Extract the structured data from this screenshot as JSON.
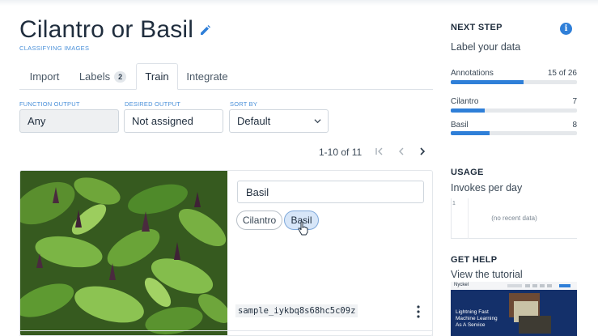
{
  "header": {
    "title": "Cilantro or Basil",
    "subtitle": "CLASSIFYING IMAGES",
    "edit_icon": "pencil-icon"
  },
  "tabs": [
    {
      "label": "Import",
      "active": false
    },
    {
      "label": "Labels",
      "badge": "2",
      "active": false
    },
    {
      "label": "Train",
      "active": true
    },
    {
      "label": "Integrate",
      "active": false
    }
  ],
  "filters": {
    "function_output": {
      "label": "FUNCTION OUTPUT",
      "value": "Any"
    },
    "desired_output": {
      "label": "DESIRED OUTPUT",
      "value": "Not assigned"
    },
    "sort_by": {
      "label": "SORT BY",
      "value": "Default"
    }
  },
  "pagination": {
    "range": "1-10 of 11",
    "icons": [
      "first-page-icon",
      "prev-page-icon",
      "next-page-icon"
    ]
  },
  "sample": {
    "label_value": "Basil",
    "chips": [
      {
        "label": "Cilantro",
        "selected": false
      },
      {
        "label": "Basil",
        "selected": true
      }
    ],
    "id": "sample_iykbq8s68hc5c09z",
    "menu_icon": "more-vertical-icon"
  },
  "sidebar": {
    "next_step": {
      "heading": "NEXT STEP",
      "text": "Label your data",
      "info_icon": "info-icon"
    },
    "metrics": [
      {
        "label": "Annotations",
        "value": "15 of 26",
        "fraction": 0.58
      },
      {
        "label": "Cilantro",
        "value": "7",
        "fraction": 0.27
      },
      {
        "label": "Basil",
        "value": "8",
        "fraction": 0.31
      }
    ],
    "usage": {
      "heading": "USAGE",
      "text": "Invokes per day",
      "axis_value": "1",
      "empty": "(no recent data)"
    },
    "help": {
      "heading": "GET HELP",
      "text": "View the tutorial",
      "thumb_brand": "Nyckel",
      "thumb_tagline": "Lightning Fast Machine Learning As A Service"
    }
  },
  "colors": {
    "accent": "#2f7fd8",
    "subtitle": "#4a90d9",
    "text": "#1f2d3d"
  }
}
